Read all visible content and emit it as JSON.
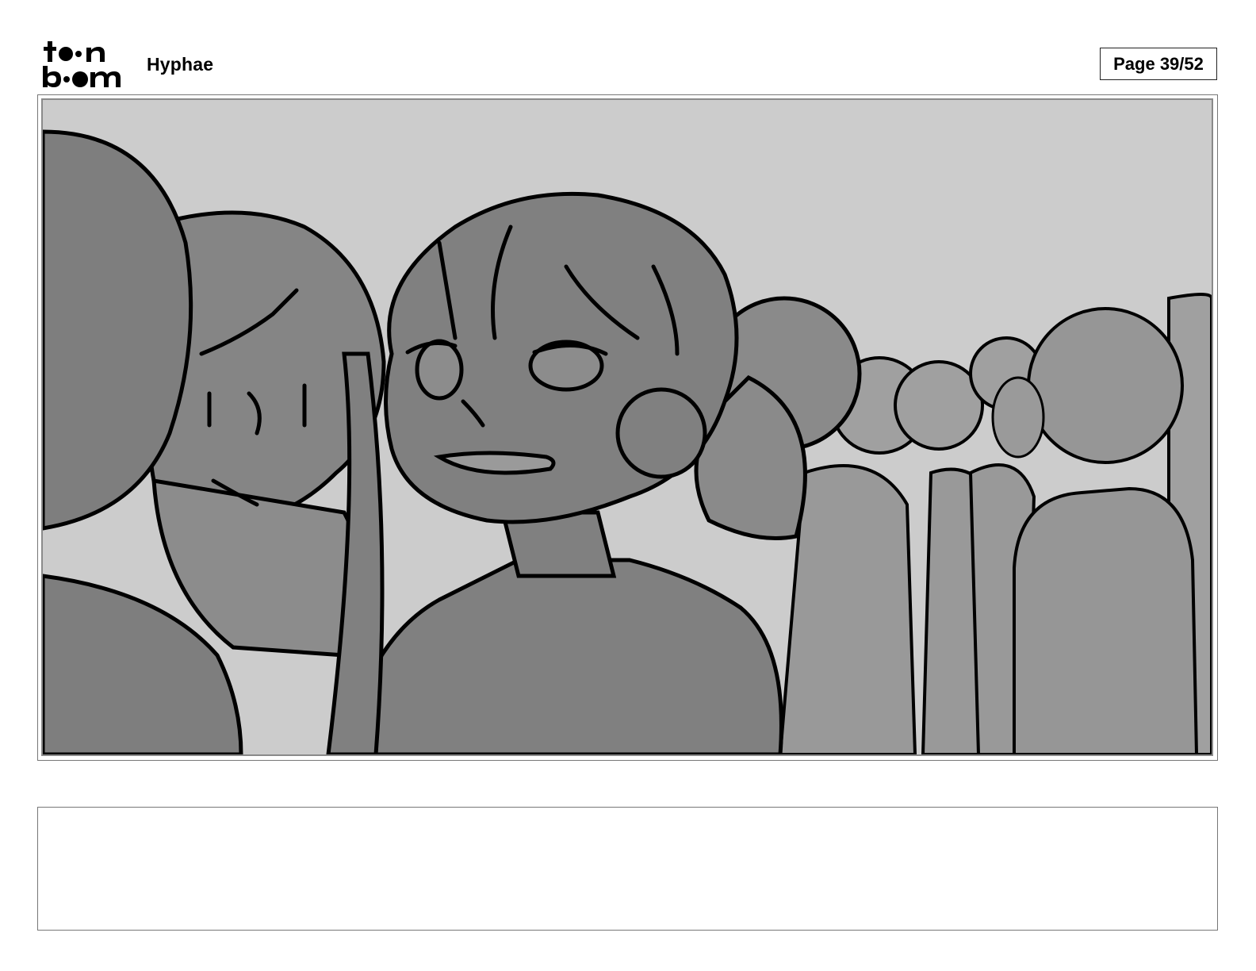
{
  "header": {
    "logo_text": "toon boom",
    "project_title": "Hyphae",
    "page_label": "Page 39/52"
  },
  "panel": {
    "notes_text": ""
  },
  "colors": {
    "sky": "#cccccc",
    "crowd_far": "#a0a0a0",
    "crowd_mid": "#959595",
    "figure_main": "#808080",
    "ink": "#000000"
  }
}
